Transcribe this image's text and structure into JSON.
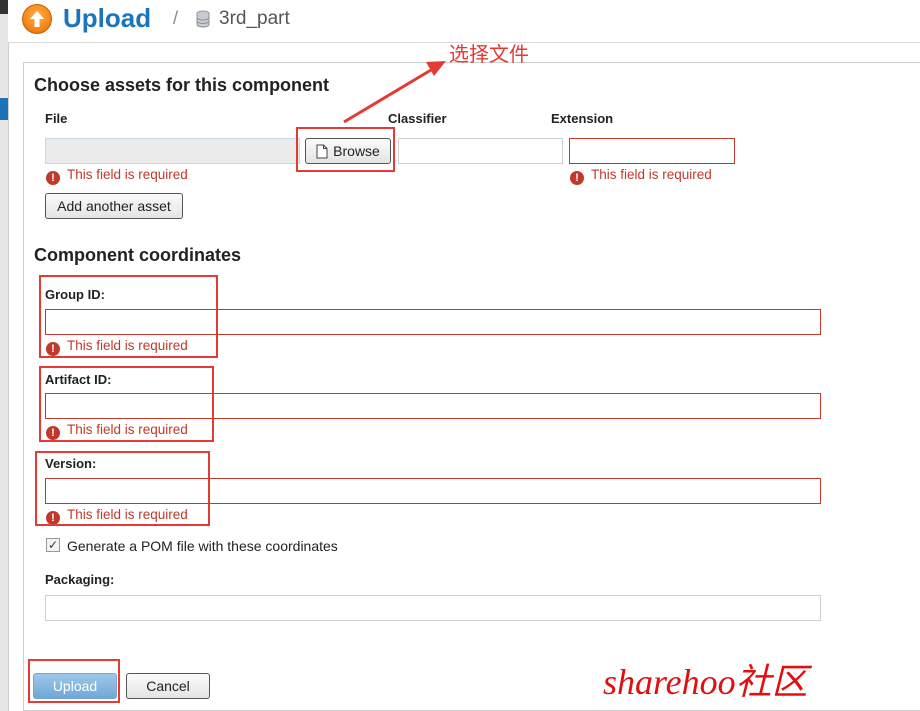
{
  "header": {
    "title": "Upload",
    "separator": "/",
    "repository": "3rd_part"
  },
  "assets": {
    "heading": "Choose assets for this component",
    "file_label": "File",
    "classifier_label": "Classifier",
    "extension_label": "Extension",
    "browse_label": "Browse",
    "file_error": "This field is required",
    "extension_error": "This field is required",
    "add_asset_label": "Add another asset"
  },
  "coordinates": {
    "heading": "Component coordinates",
    "group_label": "Group ID:",
    "group_error": "This field is required",
    "artifact_label": "Artifact ID:",
    "artifact_error": "This field is required",
    "version_label": "Version:",
    "version_error": "This field is required",
    "pom_label": "Generate a POM file with these coordinates",
    "pom_checked": true,
    "packaging_label": "Packaging:"
  },
  "actions": {
    "upload_label": "Upload",
    "cancel_label": "Cancel"
  },
  "annotations": {
    "choose_file_note": "选择文件",
    "watermark": "sharehoo社区"
  },
  "colors": {
    "brand": "#1b75bb",
    "error": "#c0392b",
    "annotation": "#e53935"
  },
  "icons": {
    "header": "upload-circle-icon",
    "repository": "database-icon",
    "browse": "file-icon",
    "error": "exclamation-icon"
  }
}
